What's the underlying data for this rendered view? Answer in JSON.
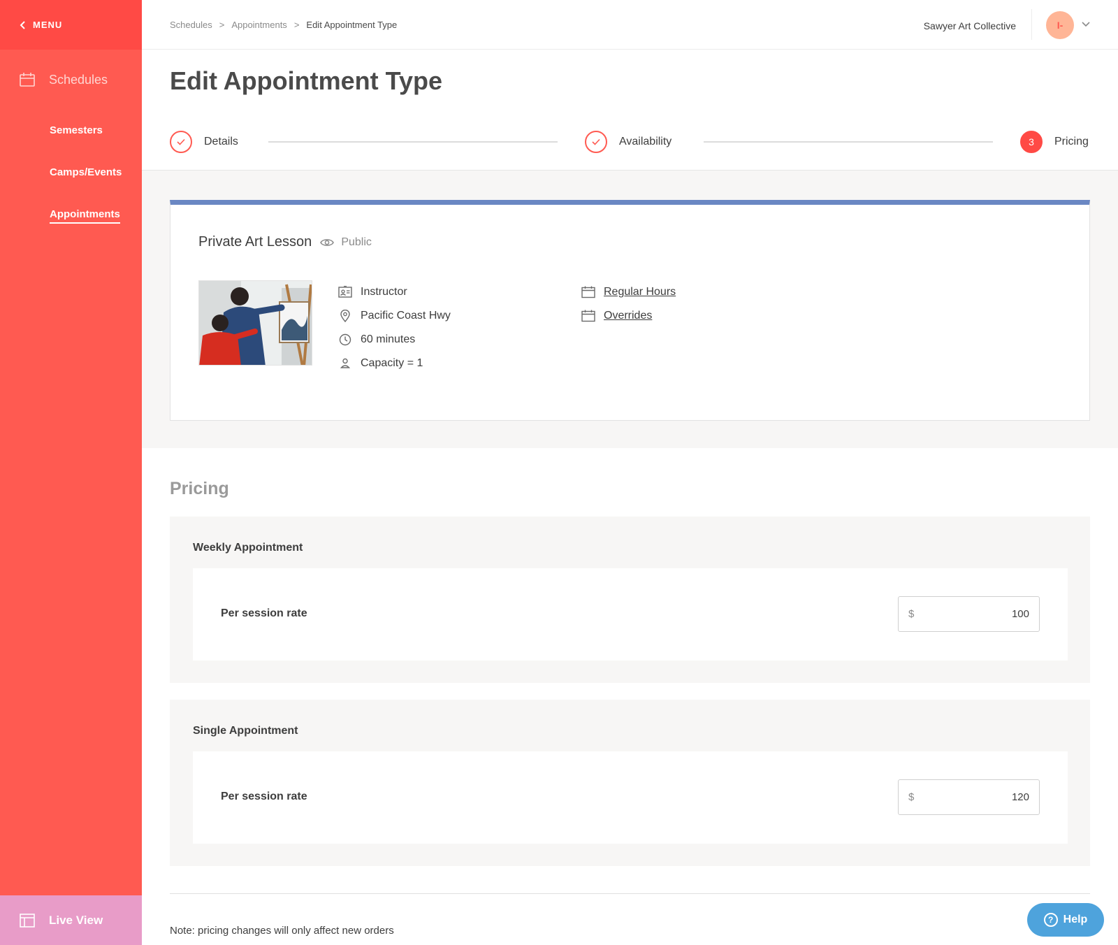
{
  "sidebar": {
    "menu_label": "MENU",
    "section_label": "Schedules",
    "items": [
      {
        "label": "Semesters"
      },
      {
        "label": "Camps/Events"
      },
      {
        "label": "Appointments"
      }
    ],
    "live_view_label": "Live View"
  },
  "breadcrumb": {
    "items": [
      "Schedules",
      "Appointments",
      "Edit Appointment Type"
    ],
    "separator": ">"
  },
  "header": {
    "org_name": "Sawyer Art Collective",
    "avatar_initials": "I-"
  },
  "page": {
    "title": "Edit Appointment Type"
  },
  "stepper": {
    "steps": [
      {
        "label": "Details",
        "state": "complete"
      },
      {
        "label": "Availability",
        "state": "complete"
      },
      {
        "label": "Pricing",
        "state": "current",
        "number": "3"
      }
    ]
  },
  "summary": {
    "title": "Private Art Lesson",
    "visibility": "Public",
    "details": [
      {
        "icon": "id-card-icon",
        "text": "Instructor"
      },
      {
        "icon": "location-pin-icon",
        "text": "Pacific Coast Hwy"
      },
      {
        "icon": "clock-icon",
        "text": "60 minutes"
      },
      {
        "icon": "person-icon",
        "text": "Capacity = 1"
      }
    ],
    "links": [
      {
        "icon": "calendar-icon",
        "text": "Regular Hours"
      },
      {
        "icon": "calendar-icon",
        "text": "Overrides"
      }
    ]
  },
  "pricing": {
    "title": "Pricing",
    "blocks": [
      {
        "label": "Weekly Appointment",
        "rate_label": "Per session rate",
        "currency": "$",
        "value": "100"
      },
      {
        "label": "Single Appointment",
        "rate_label": "Per session rate",
        "currency": "$",
        "value": "120"
      }
    ]
  },
  "footer": {
    "note": "Note: pricing changes will only affect new orders",
    "help_label": "Help"
  },
  "colors": {
    "accent": "#ff5a51",
    "sidebar_dark": "#ff4a45",
    "live_view": "#e89cc8",
    "card_top_bar": "#6a87c3",
    "help_button": "#4ea3dc"
  }
}
